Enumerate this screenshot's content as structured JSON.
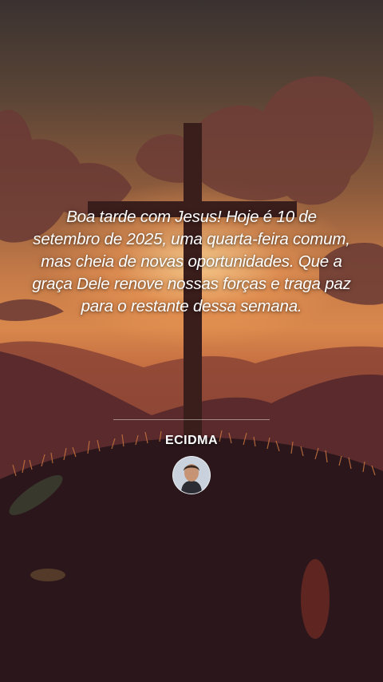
{
  "post": {
    "message": "Boa tarde com Jesus! Hoje é 10 de setembro de 2025, uma quarta-feira comum, mas cheia de novas oportunidades. Que a graça Dele renove nossas forças e traga paz para o restante dessa semana.",
    "author": "ECIDMA"
  },
  "background": {
    "scene": "sunset-hills-with-cross",
    "sky_top": "#3a3230",
    "glow": "#ffd696",
    "hills": "#2a161b",
    "cross": "#3a1e1c"
  }
}
